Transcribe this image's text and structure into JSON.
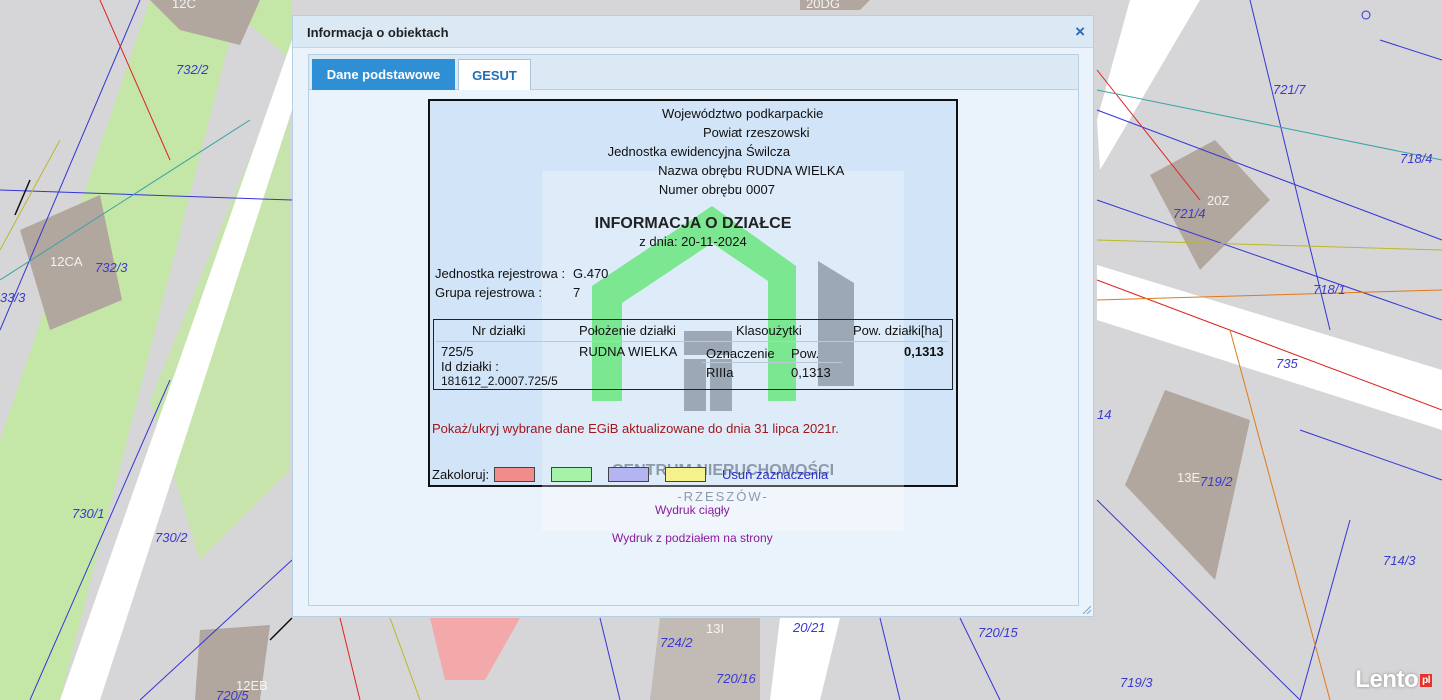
{
  "map": {
    "parcel_labels": [
      "732/2",
      "732/3",
      "33/3",
      "730/1",
      "730/2",
      "721/7",
      "718/4",
      "721/4",
      "718/1",
      "735",
      "14",
      "719/2",
      "714/3",
      "720/15",
      "720/16",
      "724/2",
      "719/3",
      "20/21",
      "720/5"
    ],
    "building_labels": [
      "12C",
      "20DG",
      "12CA",
      "20Z",
      "13E",
      "13I",
      "12EB"
    ]
  },
  "dialog": {
    "title": "Informacja o obiektach",
    "close_label": "×",
    "tabs": [
      {
        "label": "Dane podstawowe"
      },
      {
        "label": "GESUT"
      }
    ]
  },
  "info": {
    "fields": [
      {
        "key": "Województwo",
        "value": "podkarpackie"
      },
      {
        "key": "Powiat",
        "value": "rzeszowski"
      },
      {
        "key": "Jednostka ewidencyjna",
        "value": "Świlcza"
      },
      {
        "key": "Nazwa obrębu",
        "value": "RUDNA WIELKA"
      },
      {
        "key": "Numer obrębu",
        "value": "0007"
      }
    ],
    "separator": ":",
    "title": "INFORMACJA O DZIAŁCE",
    "date": "z dnia: 20-11-2024",
    "registry_unit_label": "Jednostka rejestrowa :",
    "registry_unit_value": "G.470",
    "registry_group_label": "Grupa rejestrowa :",
    "registry_group_value": "7",
    "table": {
      "headers": [
        "Nr działki",
        "Położenie działki",
        "Klasoużytki",
        "Pow. działki[ha]"
      ],
      "parcel_no": "725/5",
      "parcel_id_label": "Id działki :",
      "parcel_id": "181612_2.0007.725/5",
      "location": "RUDNA WIELKA",
      "class_headers": [
        "Oznaczenie",
        "Pow."
      ],
      "class_symbol": "RIIIa",
      "class_area": "0,1313",
      "area": "0,1313"
    },
    "toggle_link": "Pokaż/ukryj wybrane dane EGiB aktualizowane do dnia 31 lipca 2021r.",
    "colorize_label": "Zakoloruj:",
    "colors": [
      "#f08c8c",
      "#a6f2a6",
      "#b4b4f2",
      "#f5f28c"
    ],
    "clear_link": "Usuń zaznaczenia"
  },
  "print": {
    "continuous": "Wydruk ciągły",
    "paged": "Wydruk z podziałem na strony"
  },
  "watermark": {
    "line1": "CENTRUM NIERUCHOMOŚCI",
    "line2": "-RZESZÓW-"
  },
  "branding": {
    "name": "Lento",
    "suffix": "pl"
  }
}
